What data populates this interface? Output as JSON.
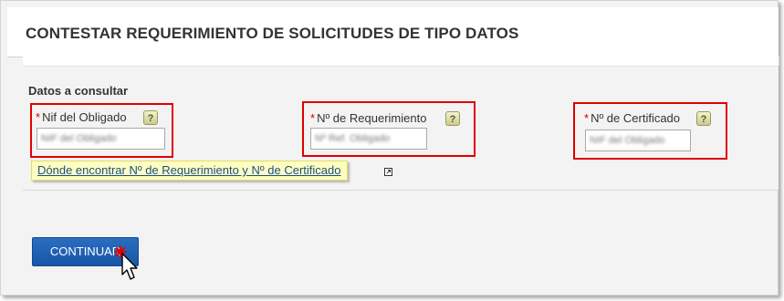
{
  "header": {
    "title": "CONTESTAR REQUERIMIENTO DE SOLICITUDES DE TIPO DATOS"
  },
  "section": {
    "title": "Datos a consultar"
  },
  "fields": [
    {
      "required_mark": "*",
      "label": "Nif del Obligado",
      "value": "NIF del Obligado",
      "help_icon": "question-mark-icon"
    },
    {
      "required_mark": "*",
      "label": "Nº de Requerimiento",
      "value": "Nº Ref. Obligado",
      "help_icon": "question-mark-icon"
    },
    {
      "required_mark": "*",
      "label": "Nº de Certificado",
      "value": "NIF del Obligado",
      "help_icon": "question-mark-icon"
    }
  ],
  "help_link": {
    "text": "Dónde encontrar Nº de Requerimiento y Nº de Certificado",
    "icon": "external-link-icon"
  },
  "actions": {
    "continue_label": "CONTINUAR"
  },
  "colors": {
    "highlight_border": "#e00000",
    "button": "#1f62b3",
    "link": "#1b4f8a",
    "tooltip_bg": "#fffdc0",
    "required": "#d40000"
  }
}
